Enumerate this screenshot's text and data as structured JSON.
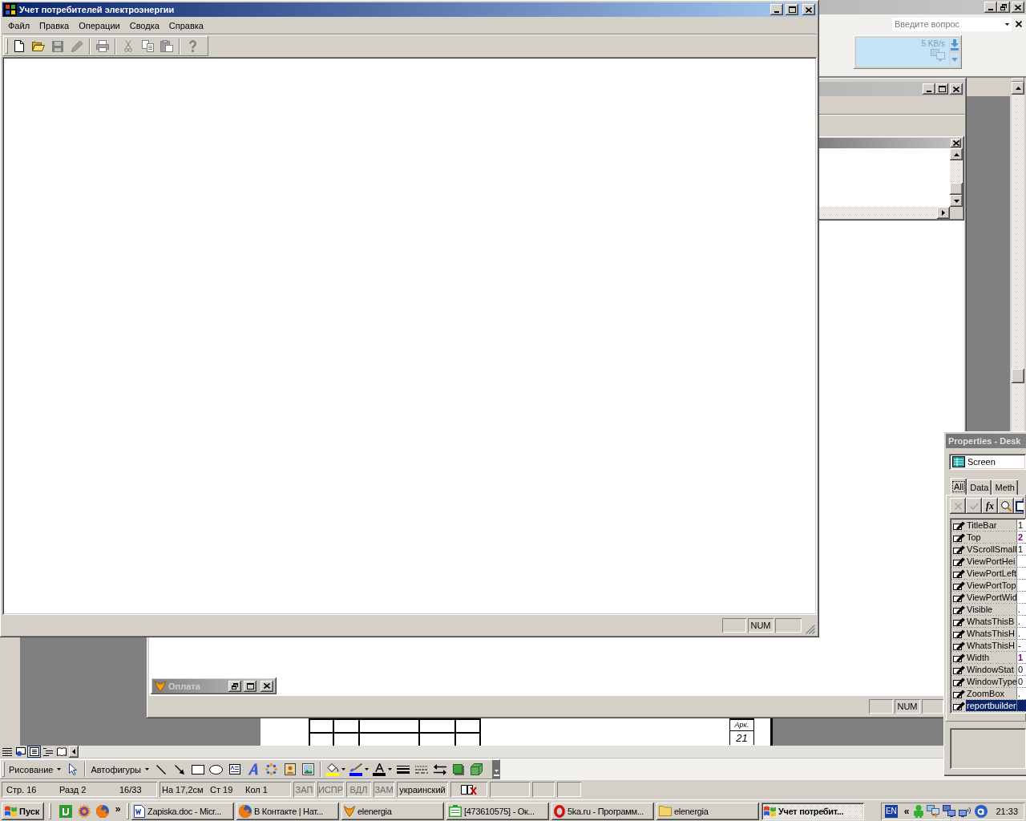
{
  "main_window": {
    "title": "Учет потребителей электроэнергии",
    "caption_buttons": [
      {
        "kind": "minimize"
      },
      {
        "kind": "maximize"
      },
      {
        "kind": "close"
      }
    ],
    "menu": [
      "Файл",
      "Правка",
      "Операции",
      "Сводка",
      "Справка"
    ],
    "toolbar": [
      {
        "kind": "new",
        "disabled": false
      },
      {
        "kind": "open",
        "disabled": false
      },
      {
        "kind": "save",
        "disabled": true
      },
      {
        "kind": "edit",
        "disabled": true
      },
      {
        "kind": "separator"
      },
      {
        "kind": "print",
        "disabled": true
      },
      {
        "kind": "separator"
      },
      {
        "kind": "cut",
        "disabled": true
      },
      {
        "kind": "copy",
        "disabled": true
      },
      {
        "kind": "paste",
        "disabled": true
      },
      {
        "kind": "separator"
      },
      {
        "kind": "help",
        "disabled": true
      }
    ],
    "status_panels": [
      {
        "kind": "blank"
      },
      {
        "kind": "text",
        "text": "NUM"
      },
      {
        "kind": "blank"
      }
    ]
  },
  "word_window": {
    "caption_buttons": [
      {
        "kind": "minimize"
      },
      {
        "kind": "restore"
      },
      {
        "kind": "close"
      }
    ],
    "help_box": {
      "placeholder": "Введите вопрос"
    },
    "speed_meter": {
      "reading": "5 KB/s"
    },
    "page": {
      "sheet_label": "Арк.",
      "sheet_number": "21"
    },
    "view_buttons": [
      {
        "kind": "normal",
        "selected": false
      },
      {
        "kind": "web",
        "selected": false
      },
      {
        "kind": "print",
        "selected": true
      },
      {
        "kind": "outline",
        "selected": false
      },
      {
        "kind": "reading",
        "selected": false
      }
    ],
    "drawing_toolbar": [
      {
        "kind": "menu",
        "label": "Рисование"
      },
      {
        "kind": "pointer"
      },
      {
        "kind": "separator"
      },
      {
        "kind": "menu",
        "label": "Автофигуры"
      },
      {
        "kind": "line"
      },
      {
        "kind": "arrow"
      },
      {
        "kind": "rectangle"
      },
      {
        "kind": "oval"
      },
      {
        "kind": "text_box"
      },
      {
        "kind": "wordart"
      },
      {
        "kind": "diagram"
      },
      {
        "kind": "clipart"
      },
      {
        "kind": "picture"
      },
      {
        "kind": "separator"
      },
      {
        "kind": "fill_color",
        "color": "#ffff00"
      },
      {
        "kind": "line_color",
        "color": "#0000ff"
      },
      {
        "kind": "font_color",
        "color": "#000000"
      },
      {
        "kind": "line_style"
      },
      {
        "kind": "dash_style"
      },
      {
        "kind": "arrow_style"
      },
      {
        "kind": "shadow"
      },
      {
        "kind": "extrusion"
      }
    ],
    "status_bar": {
      "position": [
        "Стр. 16",
        "Разд 2",
        "16/33"
      ],
      "cursor": [
        "На 17,2см",
        "Ст 19",
        "Кол 1"
      ],
      "modes": [
        {
          "label": "ЗАП",
          "on": false
        },
        {
          "label": "ИСПР",
          "on": false
        },
        {
          "label": "ВДЛ",
          "on": false
        },
        {
          "label": "ЗАМ",
          "on": false
        }
      ],
      "language": "украинский"
    }
  },
  "app_window": {
    "caption_buttons": [
      {
        "kind": "minimize"
      },
      {
        "kind": "maximize"
      },
      {
        "kind": "close"
      }
    ],
    "child_window": {
      "caption_buttons": [
        {
          "kind": "close"
        }
      ]
    },
    "minimized_window": {
      "title": "Оплата",
      "caption_buttons": [
        {
          "kind": "restore"
        },
        {
          "kind": "maximize"
        },
        {
          "kind": "close"
        }
      ]
    },
    "status_panels": [
      {
        "kind": "blank"
      },
      {
        "kind": "text",
        "text": "NUM"
      },
      {
        "kind": "blank"
      }
    ]
  },
  "properties_window": {
    "title": "Properties - Desk",
    "object": "Screen",
    "tabs": [
      {
        "label": "All",
        "selected": true
      },
      {
        "label": "Data",
        "selected": false
      },
      {
        "label": "Meth",
        "selected": false
      }
    ],
    "tools": [
      {
        "kind": "cancel",
        "disabled": true
      },
      {
        "kind": "accept",
        "disabled": true
      },
      {
        "kind": "function",
        "label": "fx",
        "disabled": false
      },
      {
        "kind": "zoom",
        "disabled": false
      },
      {
        "kind": "code",
        "disabled": false
      }
    ],
    "properties": [
      {
        "name": "TitleBar",
        "value": "1",
        "changed": false,
        "selected": false
      },
      {
        "name": "Top",
        "value": "2",
        "changed": true,
        "selected": false
      },
      {
        "name": "VScrollSmall",
        "value": "1",
        "changed": false,
        "selected": false
      },
      {
        "name": "ViewPortHei",
        "selected": false
      },
      {
        "name": "ViewPortLeft",
        "selected": false
      },
      {
        "name": "ViewPortTop",
        "selected": false
      },
      {
        "name": "ViewPortWid",
        "selected": false
      },
      {
        "name": "Visible",
        "value": ".",
        "changed": false,
        "selected": false
      },
      {
        "name": "WhatsThisB",
        "value": ".",
        "changed": false,
        "selected": false
      },
      {
        "name": "WhatsThisH",
        "value": ".",
        "changed": false,
        "selected": false
      },
      {
        "name": "WhatsThisH",
        "value": "-",
        "changed": false,
        "selected": false
      },
      {
        "name": "Width",
        "value": "1",
        "changed": true,
        "selected": false
      },
      {
        "name": "WindowStat",
        "value": "0",
        "changed": false,
        "selected": false
      },
      {
        "name": "WindowType",
        "value": "0",
        "changed": false,
        "selected": false
      },
      {
        "name": "ZoomBox",
        "value": ".",
        "changed": false,
        "selected": false
      },
      {
        "name": "reportbuilder",
        "selected": true
      }
    ]
  },
  "taskbar": {
    "start": "Пуск",
    "quick_launch": [
      {
        "kind": "tile"
      },
      {
        "kind": "gear"
      },
      {
        "kind": "globe"
      }
    ],
    "more": "»",
    "tasks": [
      {
        "label": "Zapiska.doc - Micr...",
        "kind": "document",
        "selected": false
      },
      {
        "label": "В Контакте | Нат...",
        "kind": "globe",
        "selected": false
      },
      {
        "label": "elenergia",
        "kind": "fox",
        "selected": false
      },
      {
        "label": "[473610575] - Ок...",
        "kind": "card",
        "selected": false
      },
      {
        "label": "5ka.ru - Программ...",
        "kind": "ring",
        "selected": false
      },
      {
        "label": "elenergia",
        "kind": "folder",
        "selected": false
      },
      {
        "label": "Учет потребит...",
        "kind": "flag",
        "selected": true
      }
    ],
    "language": "EN",
    "tray_toggle": "«",
    "tray_icons": [
      {
        "kind": "robot"
      },
      {
        "kind": "transfer"
      },
      {
        "kind": "computers"
      },
      {
        "kind": "wireless"
      },
      {
        "kind": "disc"
      }
    ],
    "clock": "21:33"
  }
}
